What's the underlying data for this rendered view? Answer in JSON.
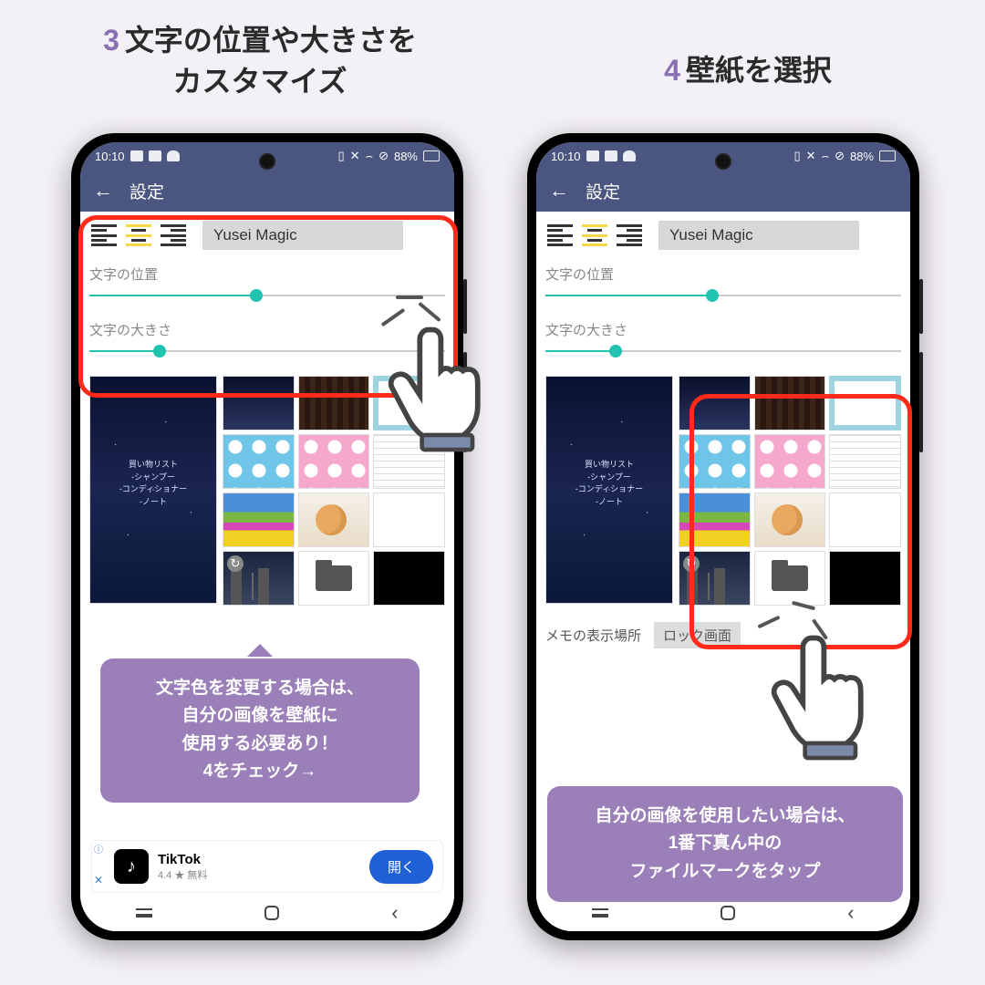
{
  "steps": {
    "s3": {
      "num": "3",
      "line1": "文字の位置や大きさを",
      "line2": "カスタマイズ"
    },
    "s4": {
      "num": "4",
      "line1": "壁紙を選択"
    }
  },
  "statusbar": {
    "time": "10:10",
    "battery": "88%"
  },
  "appbar": {
    "title": "設定"
  },
  "font_name": "Yusei Magic",
  "labels": {
    "position": "文字の位置",
    "size": "文字の大きさ",
    "memo_location": "メモの表示場所",
    "memo_value": "ロック画面"
  },
  "sliders": {
    "position_pct": 45,
    "size_pct": 18
  },
  "preview_memo": {
    "l1": "買い物リスト",
    "l2": "-シャンプー",
    "l3": "-コンディショナー",
    "l4": "-ノート"
  },
  "ad": {
    "name": "TikTok",
    "rating": "4.4 ★ 無料",
    "cta": "開く"
  },
  "speech_left": {
    "l1": "文字色を変更する場合は、",
    "l2": "自分の画像を壁紙に",
    "l3": "使用する必要あり！",
    "l4": "4をチェック→"
  },
  "speech_right": {
    "l1": "自分の画像を使用したい場合は、",
    "l2": "1番下真ん中の",
    "l3": "ファイルマークをタップ"
  }
}
